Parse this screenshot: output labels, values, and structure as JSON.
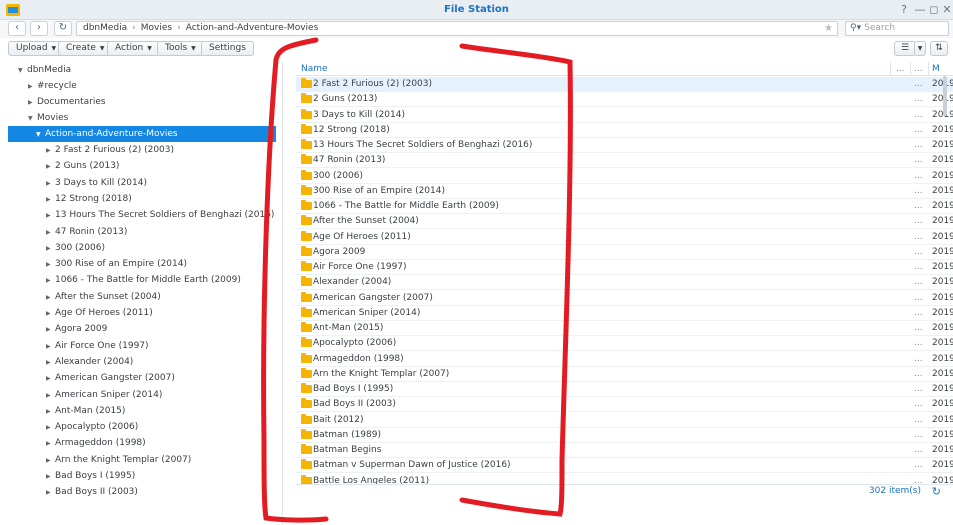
{
  "window": {
    "title": "File Station",
    "controls": [
      "?",
      "—",
      "◻",
      "✕"
    ]
  },
  "nav": {
    "back": "‹",
    "forward": "›",
    "refresh": "↻",
    "breadcrumbs": [
      "dbnMedia",
      "Movies",
      "Action-and-Adventure-Movies"
    ],
    "search_placeholder": "Search"
  },
  "toolbar": {
    "upload": "Upload",
    "create": "Create",
    "action": "Action",
    "tools": "Tools",
    "settings": "Settings"
  },
  "tree": {
    "root": "dbnMedia",
    "items": [
      "#recycle",
      "Documentaries",
      "Movies"
    ],
    "selected": "Action-and-Adventure-Movies",
    "children": [
      "2 Fast 2 Furious (2) (2003)",
      "2 Guns (2013)",
      "3 Days to Kill (2014)",
      "12 Strong (2018)",
      "13 Hours The Secret Soldiers of Benghazi (2016)",
      "47 Ronin (2013)",
      "300 (2006)",
      "300 Rise of an Empire (2014)",
      "1066 - The Battle for Middle Earth (2009)",
      "After the Sunset (2004)",
      "Age Of Heroes (2011)",
      "Agora 2009",
      "Air Force One (1997)",
      "Alexander (2004)",
      "American Gangster (2007)",
      "American Sniper (2014)",
      "Ant-Man (2015)",
      "Apocalypto (2006)",
      "Armageddon (1998)",
      "Arn the Knight Templar (2007)",
      "Bad Boys I (1995)",
      "Bad Boys II (2003)"
    ]
  },
  "list": {
    "header_name": "Name",
    "header_dots": "...",
    "header_modified": "M",
    "row_dots": "...",
    "row_date": "2019",
    "rows": [
      "2 Fast 2 Furious (2) (2003)",
      "2 Guns (2013)",
      "3 Days to Kill (2014)",
      "12 Strong (2018)",
      "13 Hours The Secret Soldiers of Benghazi (2016)",
      "47 Ronin (2013)",
      "300 (2006)",
      "300 Rise of an Empire (2014)",
      "1066 - The Battle for Middle Earth (2009)",
      "After the Sunset (2004)",
      "Age Of Heroes (2011)",
      "Agora 2009",
      "Air Force One (1997)",
      "Alexander (2004)",
      "American Gangster (2007)",
      "American Sniper (2014)",
      "Ant-Man (2015)",
      "Apocalypto (2006)",
      "Armageddon (1998)",
      "Arn the Knight Templar (2007)",
      "Bad Boys I (1995)",
      "Bad Boys II (2003)",
      "Bait (2012)",
      "Batman (1989)",
      "Batman Begins",
      "Batman v Superman Dawn of Justice (2016)",
      "Battle Los Angeles (2011)"
    ],
    "count": "302 item(s)"
  },
  "colors": {
    "accent": "#1487e5",
    "folder": "#f5b400",
    "annotation": "#e31b23"
  }
}
